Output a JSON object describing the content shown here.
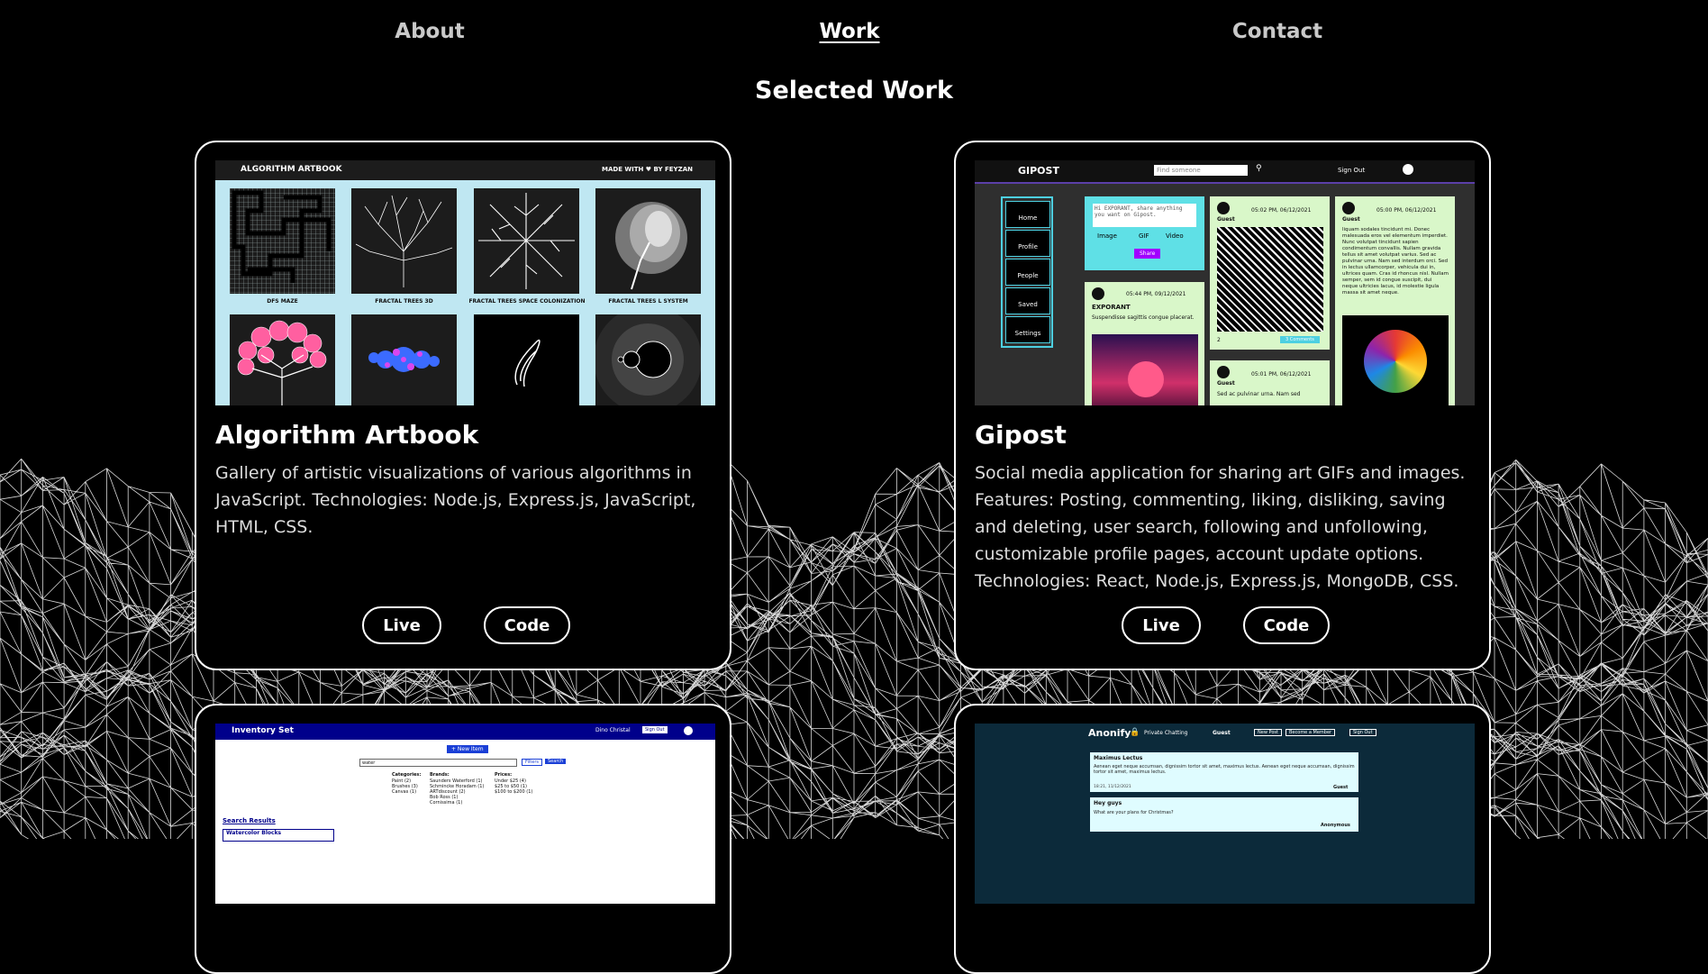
{
  "nav": {
    "about": "About",
    "work": "Work",
    "contact": "Contact"
  },
  "section_title": "Selected Work",
  "projects": [
    {
      "title": "Algorithm Artbook",
      "description": "Gallery of artistic visualizations of various algorithms in JavaScript. Technologies: Node.js, Express.js, JavaScript, HTML, CSS.",
      "live_label": "Live",
      "code_label": "Code",
      "screenshot": {
        "brand": "ALGORITHM ARTBOOK",
        "made_with": "MADE WITH ♥ BY FEYZAN",
        "tiles": [
          "DFS MAZE",
          "FRACTAL TREES 3D",
          "FRACTAL TREES SPACE COLONIZATION",
          "FRACTAL TREES L SYSTEM"
        ]
      }
    },
    {
      "title": "Gipost",
      "description": "Social media application for sharing art GIFs and images. Features: Posting, commenting, liking, disliking, saving and deleting, user search, following and unfollowing, customizable profile pages, account update options. Technologies: React, Node.js, Express.js, MongoDB, CSS.",
      "live_label": "Live",
      "code_label": "Code",
      "screenshot": {
        "brand": "GIPOST",
        "search_placeholder": "Find someone",
        "sign_out": "Sign Out",
        "menu": [
          "Home",
          "Profile",
          "People",
          "Saved",
          "Settings"
        ],
        "composer_text": "Hi EXPORANT, share anything you want on Gipost.",
        "composer_tabs": [
          "Image",
          "GIF",
          "Video"
        ],
        "share": "Share",
        "post_user_1": "EXPORANT",
        "post_time_1": "05:44 PM, 09/12/2021",
        "post_text_1": "Suspendisse sagittis congue placerat.",
        "post_user_2": "Guest",
        "post_time_2": "05:02 PM, 06/12/2021",
        "comments": "3 Comments",
        "likes": "2",
        "post_user_3": "Guest",
        "post_time_3": "05:01 PM, 06/12/2021",
        "post_text_3": "Sed ac pulvinar urna. Nam sed",
        "post_user_4": "Guest",
        "post_time_4": "05:00 PM, 06/12/2021",
        "post_text_4": "liquam sodales tincidunt mi. Donec malesuada eros vel elementum imperdiet. Nunc volutpat tincidunt sapien condimentum convallis. Nullam gravida tellus sit amet volutpat varius. Sed ac pulvinar urna. Nam sed interdum orci. Sed in lectus ullamcorper, vehicula dui in, ultrices quam. Cras id rhoncus nisl. Nullam semper, sem id congue suscipit, dui neque ultricies lacus, id molestie ligula massa sit amet neque."
      }
    },
    {
      "screenshot": {
        "brand": "Inventory Set",
        "user": "Dino Christal",
        "sign_out": "Sign Out",
        "new_item": "+ New Item",
        "search_value": "water",
        "filters": "Filters",
        "search": "Search",
        "categories_title": "Categories:",
        "categories": [
          "Paint (2)",
          "Brushes (3)",
          "Canvas (1)"
        ],
        "brands_title": "Brands:",
        "brands": [
          "Saunders Waterford (1)",
          "Schmincke Horadam (1)",
          "ARTdiscount (2)",
          "Bob Ross (1)",
          "Cornissima (1)"
        ],
        "prices_title": "Prices:",
        "prices": [
          "Under $25 (4)",
          "$25 to $50 (1)",
          "$100 to $200 (1)"
        ],
        "results_title": "Search Results",
        "result_1": "Watercolor Blocks"
      }
    },
    {
      "screenshot": {
        "brand": "Anonify",
        "subtitle": "Private Chatting",
        "user": "Guest",
        "buttons": [
          "New Post",
          "Become a Member",
          "Sign Out"
        ],
        "msg1_title": "Maximus Lectus",
        "msg1_body": "Aenean eget neque accumsan, dignissim tortor sit amet, maximus lectus. Aenean eget neque accumsan, dignissim tortor sit amet, maximus lectus.",
        "msg1_time": "18:21, 11/12/2021",
        "msg1_author": "Guest",
        "msg2_title": "Hey guys",
        "msg2_body": "What are your plans for Christmas?",
        "msg2_author": "Anonymous"
      }
    }
  ]
}
